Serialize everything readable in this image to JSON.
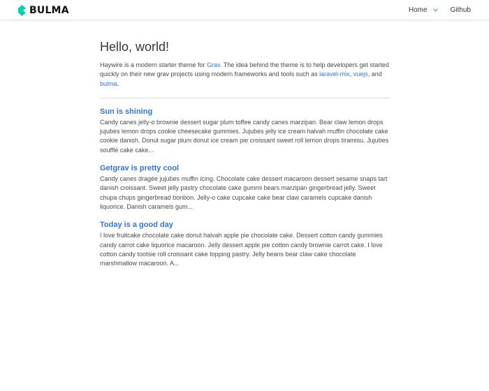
{
  "nav": {
    "brand": "BULMA",
    "items": [
      {
        "label": "Home"
      },
      {
        "label": "Github"
      }
    ],
    "brand_color": "#00d1b2"
  },
  "main": {
    "title": "Hello, world!",
    "intro": {
      "text1": "Haywire is a modern starter theme for ",
      "link_grav": "Grav",
      "text2": ". The idea behind the theme is to help developers get started quickly on their new grav projects using modern frameworks and tools such as ",
      "link_mix": "laravel-mix",
      "text3": ", ",
      "link_vue": "vuejs",
      "text4": ", and ",
      "link_bulma": "bulma",
      "text5": "."
    },
    "posts": [
      {
        "title": "Sun is shining",
        "excerpt": "Candy canes jelly-o brownie dessert sugar plum toffee candy canes marzipan. Bear claw lemon drops jujubes lemon drops cookie cheesecake gummies. Jujubes jelly ice cream halvah muffin chocolate cake cookie danish. Donut sugar plum donut ice cream pie croissant sweet roll lemon drops tiramisu. Jujubes soufflé cake cake..."
      },
      {
        "title": "Getgrav is pretty cool",
        "excerpt": "Candy canes dragée jujubes muffin icing. Chocolate cake dessert macaroon dessert sesame snaps tart danish croissant. Sweet jelly pastry chocolate cake gummi bears marzipan gingerbread jelly. Sweet chupa chups gingerbread bonbon. Jelly-o cake cupcake cake bear claw caramels cupcake danish liquorice. Danish caramels gum..."
      },
      {
        "title": "Today is a good day",
        "excerpt": "I love fruitcake chocolate cake donut halvah apple pie chocolate cake. Dessert cotton candy gummies candy carrot cake liquorice macaroon. Jelly dessert apple pie cotton candy brownie carrot cake. I love cotton candy tootsie roll croissant cake topping pastry. Jelly beans bear claw cake chocolate marshmallow macaroon. A..."
      }
    ]
  }
}
